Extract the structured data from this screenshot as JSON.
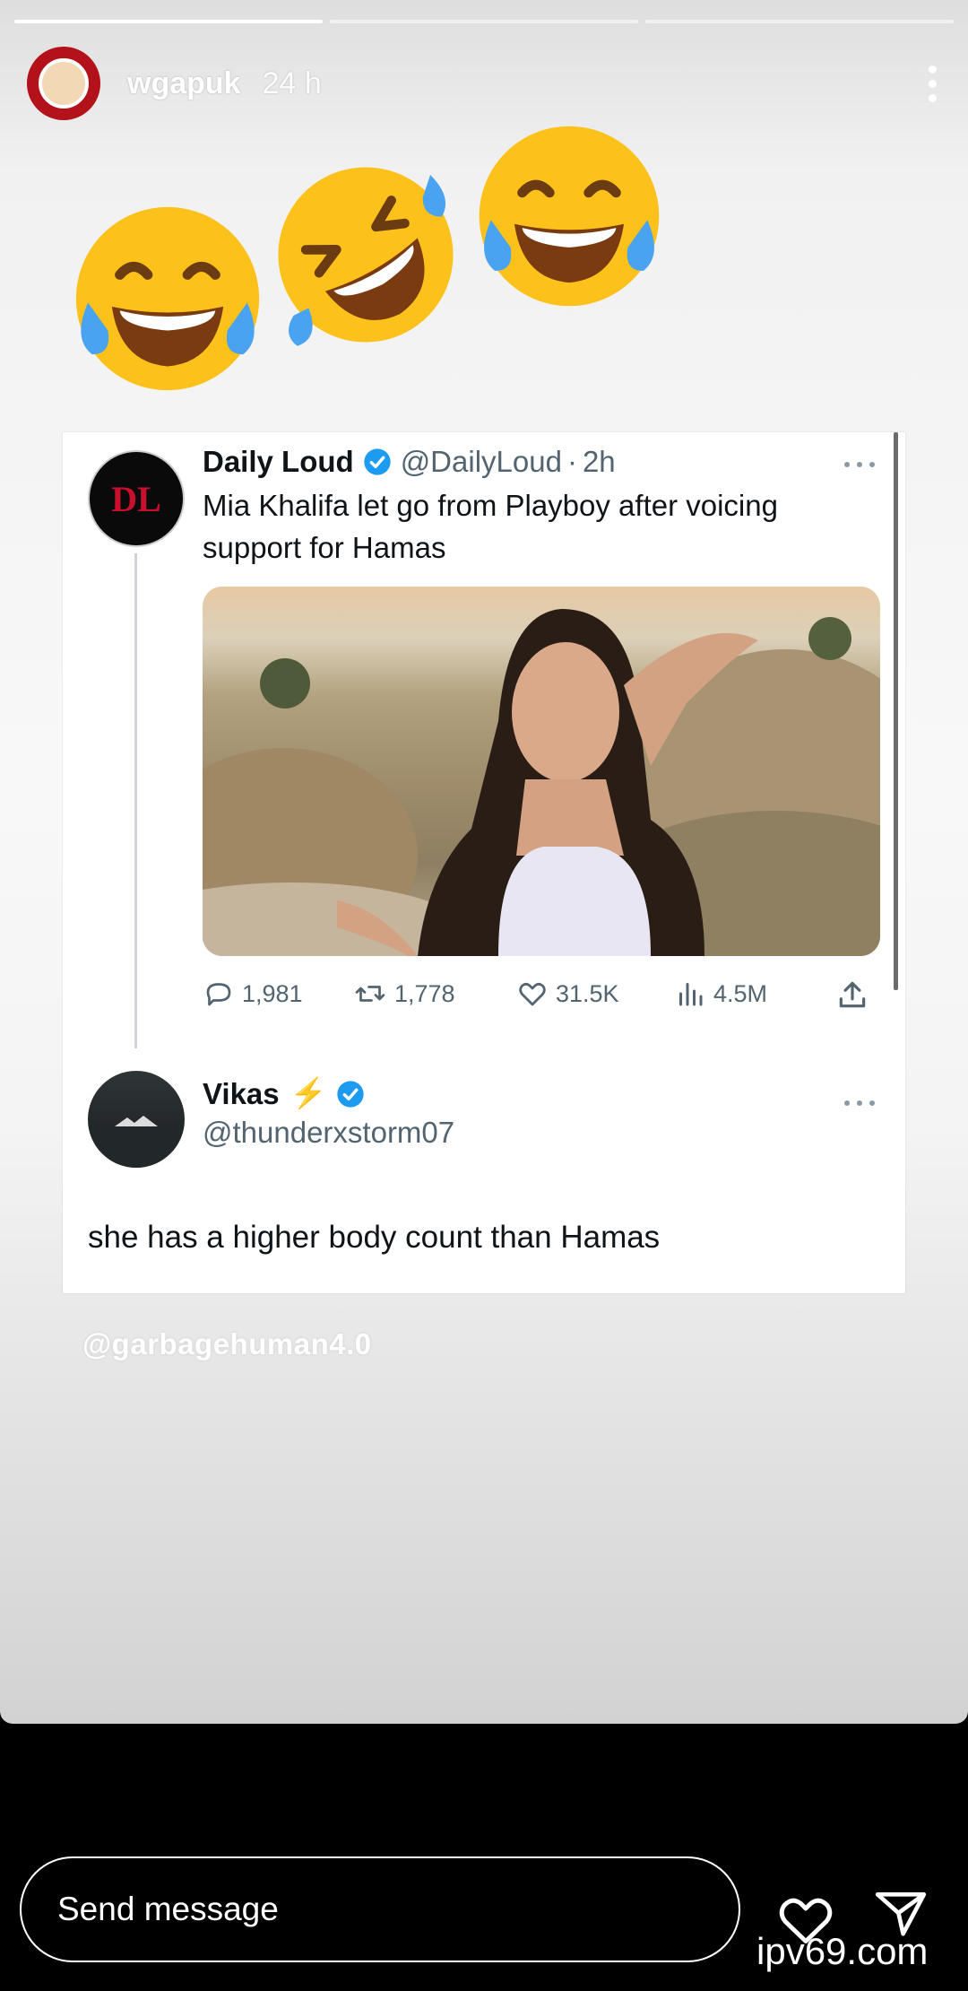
{
  "story": {
    "username": "wgapuk",
    "time": "24 h",
    "progress_segments": [
      1,
      0,
      0
    ],
    "sticker_handle": "@garbagehuman4.0"
  },
  "icons": {
    "emojis": [
      "face-with-tears-of-joy-icon",
      "rolling-on-the-floor-laughing-icon",
      "face-with-tears-of-joy-icon"
    ],
    "more": "vertical-ellipsis-icon",
    "heart": "heart-icon",
    "share": "paper-plane-icon"
  },
  "tweet": {
    "name": "Daily Loud",
    "handle": "@DailyLoud",
    "separator": "·",
    "time": "2h",
    "text": "Mia Khalifa let go from Playboy after voicing support for Hamas",
    "replies": "1,981",
    "retweets": "1,778",
    "likes": "31.5K",
    "views": "4.5M"
  },
  "reply": {
    "name": "Vikas",
    "emoji": "⚡",
    "handle": "@thunderxstorm07",
    "text": "she has a higher body count than Hamas"
  },
  "composer": {
    "placeholder": "Send message"
  },
  "watermark": "ipv69.com",
  "colors": {
    "verified": "#1d9bf0",
    "accent_red": "#c8102e",
    "text_primary": "#0f1419",
    "text_secondary": "#536471"
  }
}
